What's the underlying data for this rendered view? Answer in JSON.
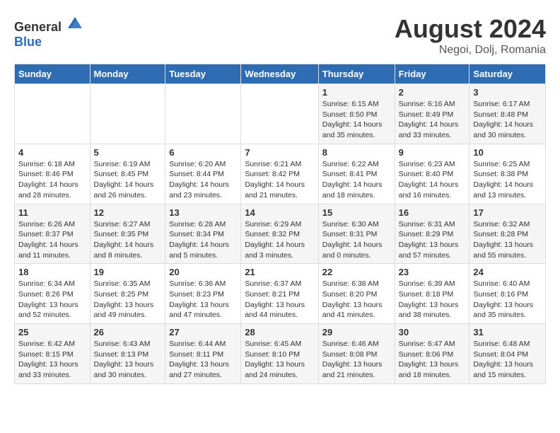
{
  "header": {
    "logo_general": "General",
    "logo_blue": "Blue",
    "month_year": "August 2024",
    "location": "Negoi, Dolj, Romania"
  },
  "days_of_week": [
    "Sunday",
    "Monday",
    "Tuesday",
    "Wednesday",
    "Thursday",
    "Friday",
    "Saturday"
  ],
  "weeks": [
    [
      {
        "day": "",
        "info": ""
      },
      {
        "day": "",
        "info": ""
      },
      {
        "day": "",
        "info": ""
      },
      {
        "day": "",
        "info": ""
      },
      {
        "day": "1",
        "info": "Sunrise: 6:15 AM\nSunset: 8:50 PM\nDaylight: 14 hours and 35 minutes."
      },
      {
        "day": "2",
        "info": "Sunrise: 6:16 AM\nSunset: 8:49 PM\nDaylight: 14 hours and 33 minutes."
      },
      {
        "day": "3",
        "info": "Sunrise: 6:17 AM\nSunset: 8:48 PM\nDaylight: 14 hours and 30 minutes."
      }
    ],
    [
      {
        "day": "4",
        "info": "Sunrise: 6:18 AM\nSunset: 8:46 PM\nDaylight: 14 hours and 28 minutes."
      },
      {
        "day": "5",
        "info": "Sunrise: 6:19 AM\nSunset: 8:45 PM\nDaylight: 14 hours and 26 minutes."
      },
      {
        "day": "6",
        "info": "Sunrise: 6:20 AM\nSunset: 8:44 PM\nDaylight: 14 hours and 23 minutes."
      },
      {
        "day": "7",
        "info": "Sunrise: 6:21 AM\nSunset: 8:42 PM\nDaylight: 14 hours and 21 minutes."
      },
      {
        "day": "8",
        "info": "Sunrise: 6:22 AM\nSunset: 8:41 PM\nDaylight: 14 hours and 18 minutes."
      },
      {
        "day": "9",
        "info": "Sunrise: 6:23 AM\nSunset: 8:40 PM\nDaylight: 14 hours and 16 minutes."
      },
      {
        "day": "10",
        "info": "Sunrise: 6:25 AM\nSunset: 8:38 PM\nDaylight: 14 hours and 13 minutes."
      }
    ],
    [
      {
        "day": "11",
        "info": "Sunrise: 6:26 AM\nSunset: 8:37 PM\nDaylight: 14 hours and 11 minutes."
      },
      {
        "day": "12",
        "info": "Sunrise: 6:27 AM\nSunset: 8:35 PM\nDaylight: 14 hours and 8 minutes."
      },
      {
        "day": "13",
        "info": "Sunrise: 6:28 AM\nSunset: 8:34 PM\nDaylight: 14 hours and 5 minutes."
      },
      {
        "day": "14",
        "info": "Sunrise: 6:29 AM\nSunset: 8:32 PM\nDaylight: 14 hours and 3 minutes."
      },
      {
        "day": "15",
        "info": "Sunrise: 6:30 AM\nSunset: 8:31 PM\nDaylight: 14 hours and 0 minutes."
      },
      {
        "day": "16",
        "info": "Sunrise: 6:31 AM\nSunset: 8:29 PM\nDaylight: 13 hours and 57 minutes."
      },
      {
        "day": "17",
        "info": "Sunrise: 6:32 AM\nSunset: 8:28 PM\nDaylight: 13 hours and 55 minutes."
      }
    ],
    [
      {
        "day": "18",
        "info": "Sunrise: 6:34 AM\nSunset: 8:26 PM\nDaylight: 13 hours and 52 minutes."
      },
      {
        "day": "19",
        "info": "Sunrise: 6:35 AM\nSunset: 8:25 PM\nDaylight: 13 hours and 49 minutes."
      },
      {
        "day": "20",
        "info": "Sunrise: 6:36 AM\nSunset: 8:23 PM\nDaylight: 13 hours and 47 minutes."
      },
      {
        "day": "21",
        "info": "Sunrise: 6:37 AM\nSunset: 8:21 PM\nDaylight: 13 hours and 44 minutes."
      },
      {
        "day": "22",
        "info": "Sunrise: 6:38 AM\nSunset: 8:20 PM\nDaylight: 13 hours and 41 minutes."
      },
      {
        "day": "23",
        "info": "Sunrise: 6:39 AM\nSunset: 8:18 PM\nDaylight: 13 hours and 38 minutes."
      },
      {
        "day": "24",
        "info": "Sunrise: 6:40 AM\nSunset: 8:16 PM\nDaylight: 13 hours and 35 minutes."
      }
    ],
    [
      {
        "day": "25",
        "info": "Sunrise: 6:42 AM\nSunset: 8:15 PM\nDaylight: 13 hours and 33 minutes."
      },
      {
        "day": "26",
        "info": "Sunrise: 6:43 AM\nSunset: 8:13 PM\nDaylight: 13 hours and 30 minutes."
      },
      {
        "day": "27",
        "info": "Sunrise: 6:44 AM\nSunset: 8:11 PM\nDaylight: 13 hours and 27 minutes."
      },
      {
        "day": "28",
        "info": "Sunrise: 6:45 AM\nSunset: 8:10 PM\nDaylight: 13 hours and 24 minutes."
      },
      {
        "day": "29",
        "info": "Sunrise: 6:46 AM\nSunset: 8:08 PM\nDaylight: 13 hours and 21 minutes."
      },
      {
        "day": "30",
        "info": "Sunrise: 6:47 AM\nSunset: 8:06 PM\nDaylight: 13 hours and 18 minutes."
      },
      {
        "day": "31",
        "info": "Sunrise: 6:48 AM\nSunset: 8:04 PM\nDaylight: 13 hours and 15 minutes."
      }
    ]
  ]
}
